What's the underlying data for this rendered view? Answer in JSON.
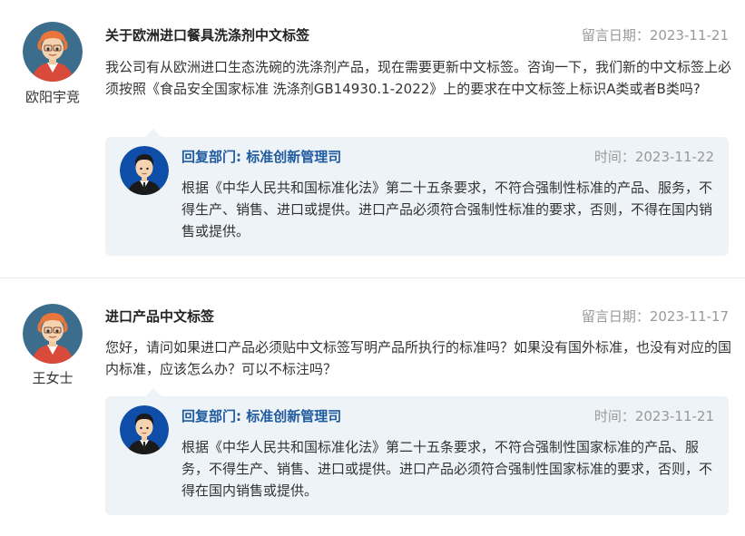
{
  "messages": [
    {
      "user": "欧阳宇竞",
      "title": "关于欧洲进口餐具洗涤剂中文标签",
      "date_text": "留言日期：2023-11-21",
      "question": "我公司有从欧洲进口生态洗碗的洗涤剂产品，现在需要更新中文标签。咨询一下，我们新的中文标签上必须按照《食品安全国家标准 洗涤剂GB14930.1-2022》上的要求在中文标签上标识A类或者B类吗?",
      "reply": {
        "dept": "回复部门: 标准创新管理司",
        "time_text": "时间：2023-11-22",
        "text": "根据《中华人民共和国标准化法》第二十五条要求，不符合强制性标准的产品、服务，不得生产、销售、进口或提供。进口产品必须符合强制性标准的要求，否则，不得在国内销售或提供。"
      }
    },
    {
      "user": "王女士",
      "title": "进口产品中文标签",
      "date_text": "留言日期：2023-11-17",
      "question": "您好，请问如果进口产品必须贴中文标签写明产品所执行的标准吗？如果没有国外标准，也没有对应的国内标准，应该怎么办？可以不标注吗？",
      "reply": {
        "dept": "回复部门: 标准创新管理司",
        "time_text": "时间：2023-11-21",
        "text": "根据《中华人民共和国标准化法》第二十五条要求，不符合强制性国家标准的产品、服务，不得生产、销售、进口或提供。进口产品必须符合强制性国家标准的要求，否则，不得在国内销售或提供。"
      }
    }
  ],
  "colors": {
    "dept_blue": "#1f5a9e",
    "reply_bg": "#eef3f8",
    "muted_gray": "#999999"
  },
  "icons": {
    "user_avatar": "user-avatar-icon",
    "official_avatar": "official-avatar-icon"
  }
}
